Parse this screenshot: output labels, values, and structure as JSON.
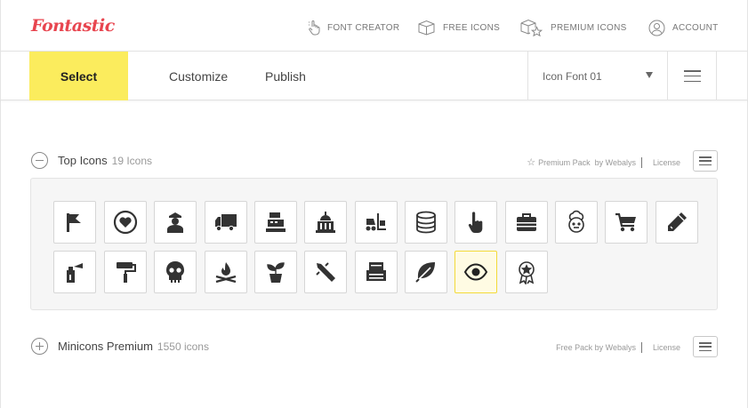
{
  "brand": {
    "logo": "Fontastic",
    "color": "#e8454f"
  },
  "topnav": [
    {
      "label": "FONT CREATOR",
      "icon": "cursor-pointer-icon"
    },
    {
      "label": "FREE ICONS",
      "icon": "cube-icon"
    },
    {
      "label": "PREMIUM ICONS",
      "icon": "cube-star-icon"
    },
    {
      "label": "ACCOUNT",
      "icon": "user-circle-icon"
    }
  ],
  "tabs": {
    "select": "Select",
    "customize": "Customize",
    "publish": "Publish"
  },
  "font_select": {
    "value": "Icon Font 01"
  },
  "accent": "#fbec5d",
  "sets": [
    {
      "title": "Top Icons",
      "count": "19 Icons",
      "pack": "Premium Pack",
      "by": "by Webalys",
      "license": "License",
      "expanded": true,
      "icons": [
        {
          "name": "flag-icon",
          "selected": true
        },
        {
          "name": "heart-circle-icon",
          "selected": true
        },
        {
          "name": "police-officer-icon",
          "selected": false
        },
        {
          "name": "truck-icon",
          "selected": false
        },
        {
          "name": "cash-register-icon",
          "selected": false
        },
        {
          "name": "capitol-building-icon",
          "selected": false
        },
        {
          "name": "forklift-icon",
          "selected": false
        },
        {
          "name": "database-icon",
          "selected": false
        },
        {
          "name": "hand-pointer-icon",
          "selected": false
        },
        {
          "name": "briefcase-icon",
          "selected": false
        },
        {
          "name": "chef-icon",
          "selected": false
        },
        {
          "name": "shopping-cart-icon",
          "selected": false
        },
        {
          "name": "pencil-icon",
          "selected": false
        },
        {
          "name": "spray-can-icon",
          "selected": false
        },
        {
          "name": "paint-roller-icon",
          "selected": false
        },
        {
          "name": "skull-icon",
          "selected": false
        },
        {
          "name": "campfire-icon",
          "selected": false
        },
        {
          "name": "plant-pot-icon",
          "selected": false
        },
        {
          "name": "rocket-icon",
          "selected": false
        },
        {
          "name": "inbox-tray-icon",
          "selected": false
        },
        {
          "name": "leaf-icon",
          "selected": false
        },
        {
          "name": "eye-icon",
          "selected": true
        },
        {
          "name": "award-ribbon-icon",
          "selected": false
        }
      ]
    },
    {
      "title": "Minicons Premium",
      "count": "1550 icons",
      "pack": "Free Pack",
      "by": "by Webalys",
      "license": "License",
      "expanded": false
    }
  ]
}
